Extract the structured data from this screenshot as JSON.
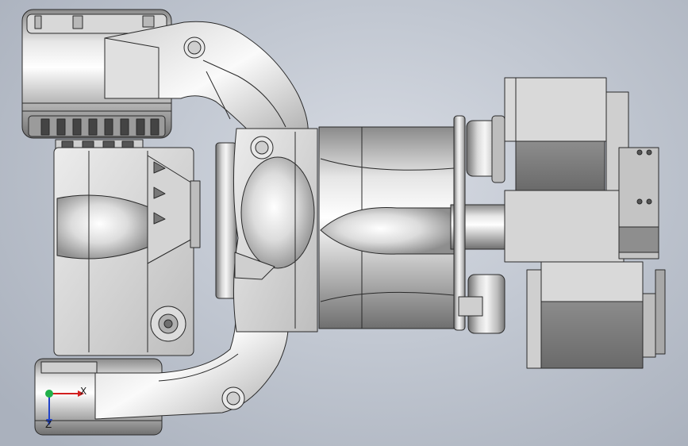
{
  "viewport": {
    "background_center": "#d7dbe3",
    "background_edge": "#aab1bd"
  },
  "model": {
    "body_light": "#f2f2f2",
    "body_mid": "#c9c9c9",
    "body_dark": "#7d7d7d",
    "edge": "#2a2a2a"
  },
  "triad": {
    "x_label": "X",
    "z_label": "Z",
    "x_color": "#d21f1f",
    "y_color": "#22b04b",
    "z_color": "#2143c8"
  }
}
